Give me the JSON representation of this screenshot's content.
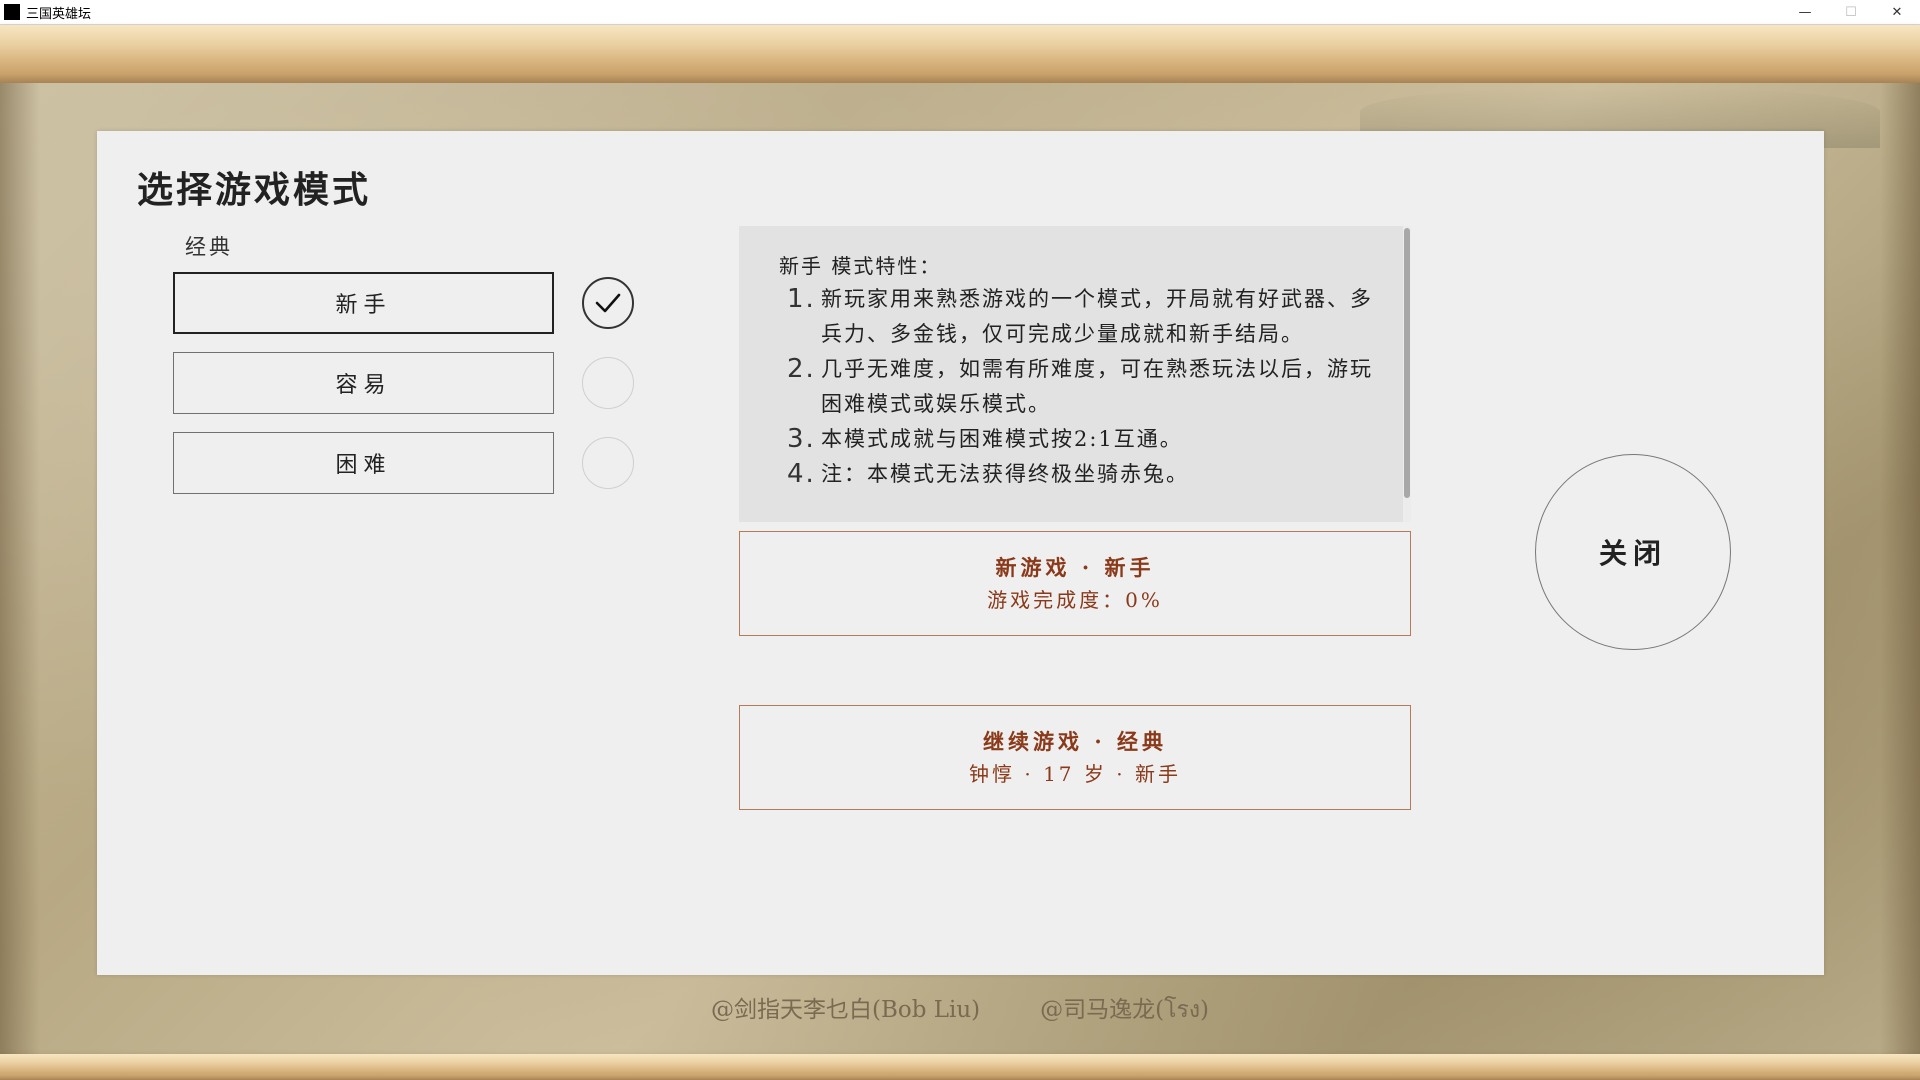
{
  "window": {
    "title": "三国英雄坛",
    "minimize_label": "—",
    "maximize_label": "☐",
    "close_label": "✕"
  },
  "dialog": {
    "title": "选择游戏模式",
    "category": "经典",
    "modes": [
      {
        "label": "新手",
        "selected": true
      },
      {
        "label": "容易",
        "selected": false
      },
      {
        "label": "困难",
        "selected": false
      }
    ],
    "description": {
      "title": "新手 模式特性：",
      "items": [
        {
          "num": "1.",
          "text": "新玩家用来熟悉游戏的一个模式，开局就有好武器、多兵力、多金钱，仅可完成少量成就和新手结局。"
        },
        {
          "num": "2.",
          "text": "几乎无难度，如需有所难度，可在熟悉玩法以后，游玩困难模式或娱乐模式。"
        },
        {
          "num": "3.",
          "text": "本模式成就与困难模式按2:1互通。"
        },
        {
          "num": "4.",
          "text": "注：本模式无法获得终极坐骑赤兔。"
        }
      ]
    },
    "new_game": {
      "line1": "新游戏 · 新手",
      "line2": "游戏完成度：0%"
    },
    "continue_game": {
      "line1": "继续游戏 · 经典",
      "line2": "钟惇 · 17 岁 · 新手"
    },
    "close_label": "关闭"
  },
  "credits": [
    "@剑指天李乜白(Bob Liu)",
    "@司马逸龙(โรง)"
  ],
  "colors": {
    "accent_brown": "#8a3a1a",
    "panel_bg": "#efefef",
    "scroll_gold": "#d7b27c"
  }
}
